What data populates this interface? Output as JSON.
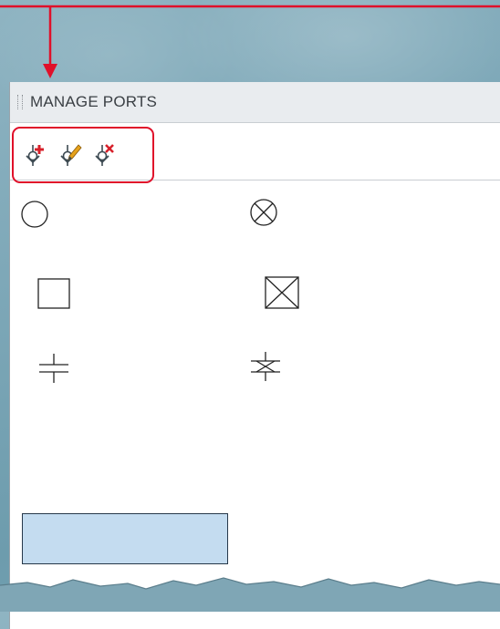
{
  "panel": {
    "title": "MANAGE PORTS"
  },
  "toolbar": {
    "buttons": [
      {
        "name": "add-port",
        "icon": "port-add-icon"
      },
      {
        "name": "edit-port",
        "icon": "port-edit-icon"
      },
      {
        "name": "delete-port",
        "icon": "port-delete-icon"
      }
    ]
  },
  "symbols": [
    {
      "name": "circle-port-symbol",
      "icon": "circle"
    },
    {
      "name": "circle-cross-port-symbol",
      "icon": "circle-with-x"
    },
    {
      "name": "square-port-symbol",
      "icon": "square"
    },
    {
      "name": "square-cross-port-symbol",
      "icon": "square-with-x"
    },
    {
      "name": "line-port-symbol",
      "icon": "parallel-lines"
    },
    {
      "name": "line-cross-port-symbol",
      "icon": "parallel-lines-with-x"
    }
  ],
  "colors": {
    "annotation": "#e0102a",
    "selection_fill": "#c4dcf0",
    "selection_border": "#27384a"
  }
}
